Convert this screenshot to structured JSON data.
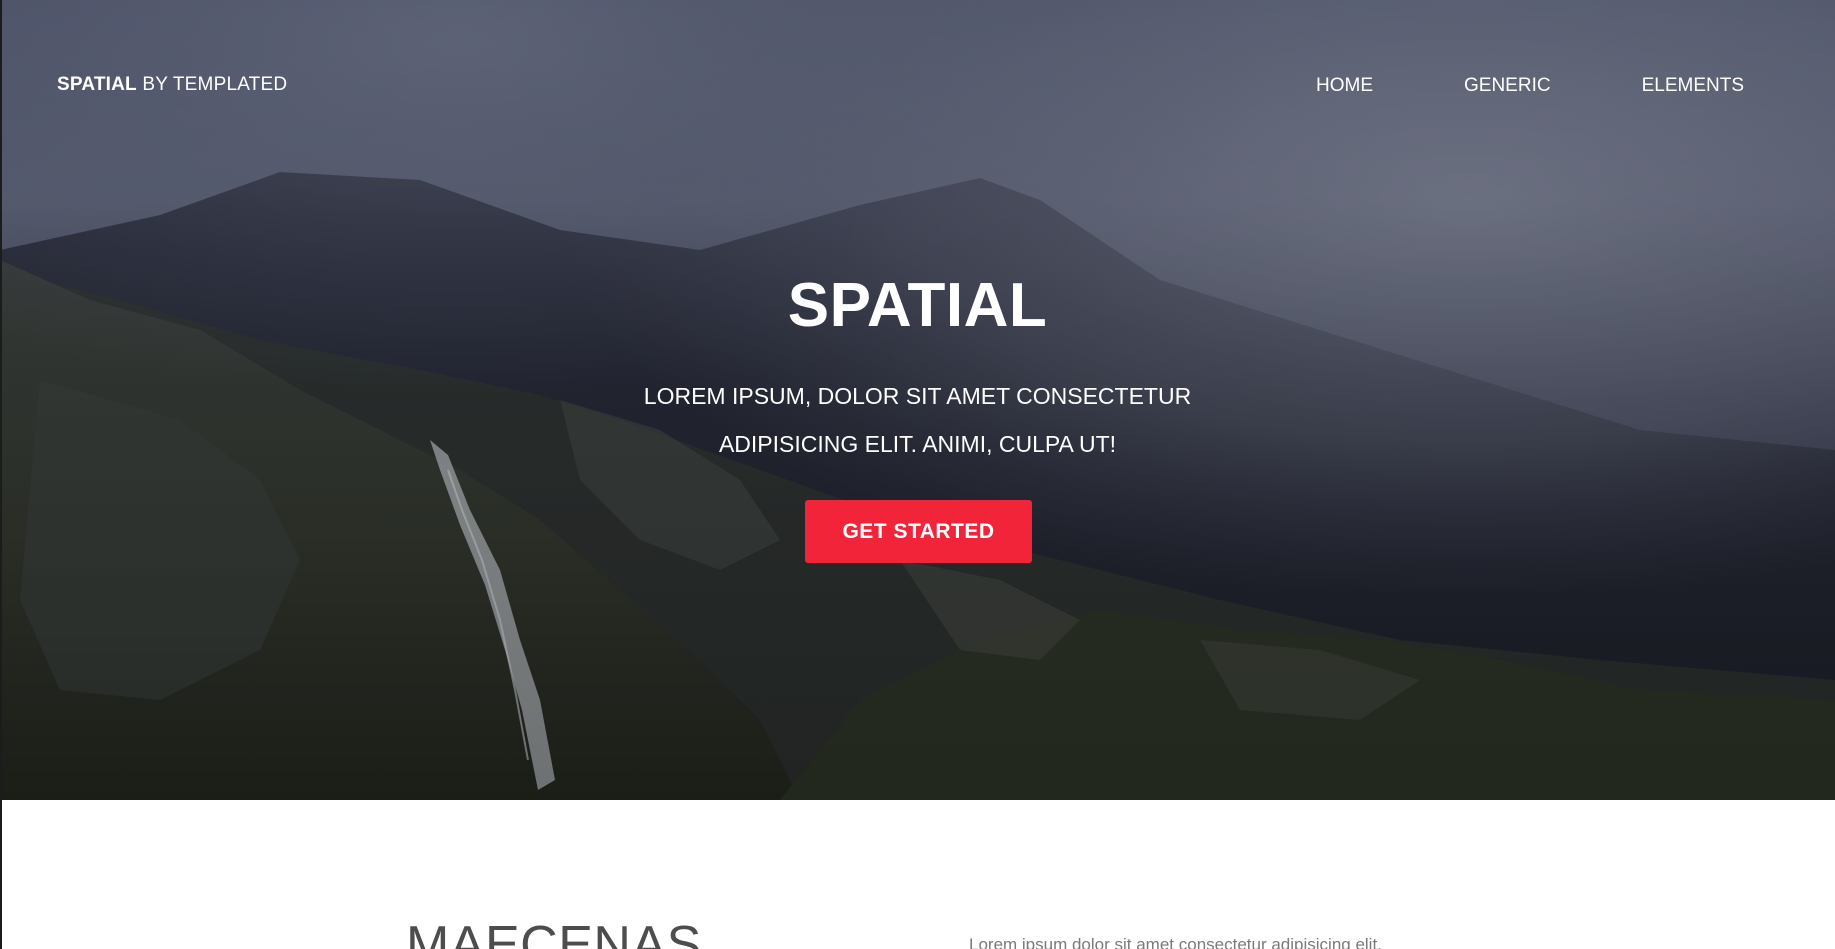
{
  "header": {
    "brand_strong": "SPATIAL",
    "brand_rest": " BY TEMPLATED",
    "nav": {
      "home": "HOME",
      "generic": "GENERIC",
      "elements": "ELEMENTS"
    }
  },
  "hero": {
    "title": "SPATIAL",
    "subtitle_line1": "LOREM IPSUM, DOLOR SIT AMET CONSECTETUR",
    "subtitle_line2": "ADIPISICING ELIT. ANIMI, CULPA UT!",
    "cta_label": "GET STARTED",
    "background_image": "misty-mountain-waterfall"
  },
  "section": {
    "heading": "MAECENAS",
    "text": "Lorem ipsum dolor sit amet consectetur adipisicing elit."
  },
  "colors": {
    "accent": "#f2243a",
    "text_light": "#ffffff",
    "heading_dark": "#4d4d4d",
    "body_gray": "#7a7a7a"
  }
}
